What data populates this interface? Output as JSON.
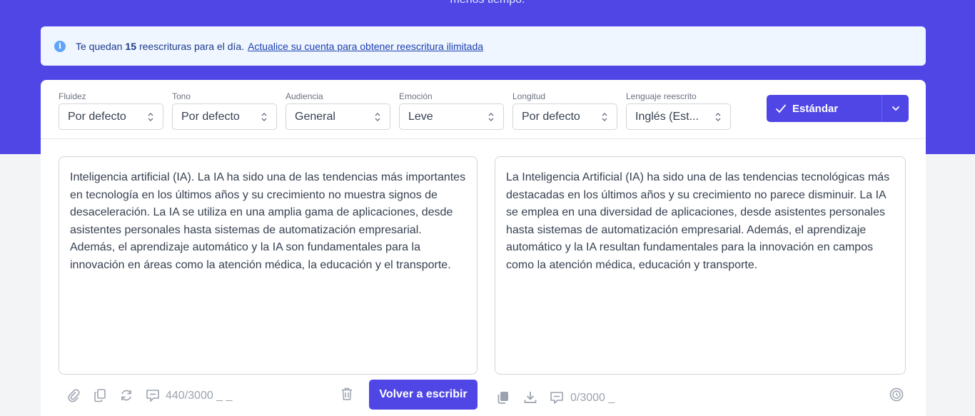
{
  "hero": {
    "text": "menos tiempo."
  },
  "notice": {
    "prefix": "Te quedan",
    "count": "15",
    "suffix": "reescrituras para el día.",
    "link": "Actualice su cuenta para obtener reescritura ilimitada"
  },
  "controls": [
    {
      "label": "Fluidez",
      "value": "Por defecto"
    },
    {
      "label": "Tono",
      "value": "Por defecto"
    },
    {
      "label": "Audiencia",
      "value": "General"
    },
    {
      "label": "Emoción",
      "value": "Leve"
    },
    {
      "label": "Longitud",
      "value": "Por defecto"
    },
    {
      "label": "Lenguaje reescrito",
      "value": "Inglés (Est..."
    }
  ],
  "mode_button": {
    "label": "Estándar"
  },
  "input": {
    "text": "Inteligencia artificial (IA). La IA ha sido una de las tendencias más importantes en tecnología en los últimos años y su crecimiento no muestra signos de desaceleración. La IA se utiliza en una amplia gama de aplicaciones, desde asistentes personales hasta sistemas de automatización empresarial. Además, el aprendizaje automático y la IA son fundamentales para la innovación en áreas como la atención médica, la educación y el transporte.",
    "counter": "440/3000 _ _"
  },
  "output": {
    "text": "La Inteligencia Artificial (IA) ha sido una de las tendencias tecnológicas más destacadas en los últimos años y su crecimiento no parece disminuir. La IA se emplea en una diversidad de aplicaciones, desde asistentes personales hasta sistemas de automatización empresarial. Además, el aprendizaje automático y la IA resultan fundamentales para la innovación en campos como la atención médica, educación y transporte.",
    "counter": "0/3000 _"
  },
  "actions": {
    "rewrite_label": "Volver a escribir"
  },
  "colors": {
    "primary": "#4f46e5",
    "notice_bg": "#eff6ff",
    "info": "#60a5fa"
  }
}
